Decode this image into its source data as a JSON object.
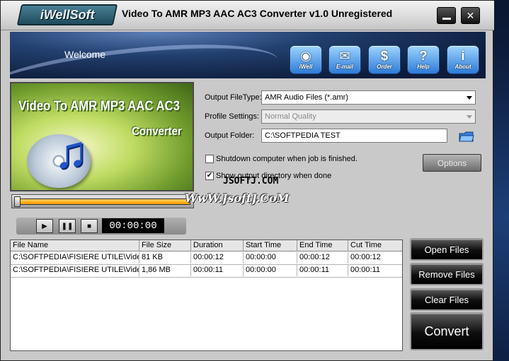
{
  "window": {
    "brand": "iWellSoft",
    "title": "Video To AMR MP3 AAC AC3 Converter v1.0 Unregistered"
  },
  "banner": {
    "welcome": "Welcome",
    "buttons": [
      {
        "label": "iWell",
        "glyph": "◉"
      },
      {
        "label": "E-mail",
        "glyph": "✉"
      },
      {
        "label": "Order",
        "glyph": "$"
      },
      {
        "label": "Help",
        "glyph": "?"
      },
      {
        "label": "About",
        "glyph": "i"
      }
    ]
  },
  "preview": {
    "title_line1": "Video To AMR MP3 AAC AC3",
    "title_line2": "Converter"
  },
  "player": {
    "time": "00:00:00",
    "progress": 1.0
  },
  "settings": {
    "output_filetype_label": "Output FileType:",
    "output_filetype_value": "AMR Audio Files (*.amr)",
    "profile_label": "Profile Settings:",
    "profile_value": "Normal Quality",
    "folder_label": "Output Folder:",
    "folder_value": "C:\\SOFTPEDIA TEST",
    "shutdown_label": "Shutdown computer when job is finished.",
    "shutdown_checked": false,
    "show_dir_label": "Show output directory when done",
    "show_dir_checked": true,
    "options_label": "Options"
  },
  "watermark": {
    "line1": "JSOFTJ.COM",
    "line2": "WwW.JsoftJ.CoM"
  },
  "table": {
    "headers": [
      "File Name",
      "File Size",
      "Duration",
      "Start Time",
      "End Time",
      "Cut Time"
    ],
    "rows": [
      [
        "C:\\SOFTPEDIA\\FISIERE UTILE\\Vide",
        "81 KB",
        "00:00:12",
        "00:00:00",
        "00:00:12",
        "00:00:12"
      ],
      [
        "C:\\SOFTPEDIA\\FISIERE UTILE\\Vide",
        "1,86 MB",
        "00:00:11",
        "00:00:00",
        "00:00:11",
        "00:00:11"
      ]
    ]
  },
  "actions": {
    "open": "Open Files",
    "remove": "Remove Files",
    "clear": "Clear Files",
    "convert": "Convert"
  }
}
